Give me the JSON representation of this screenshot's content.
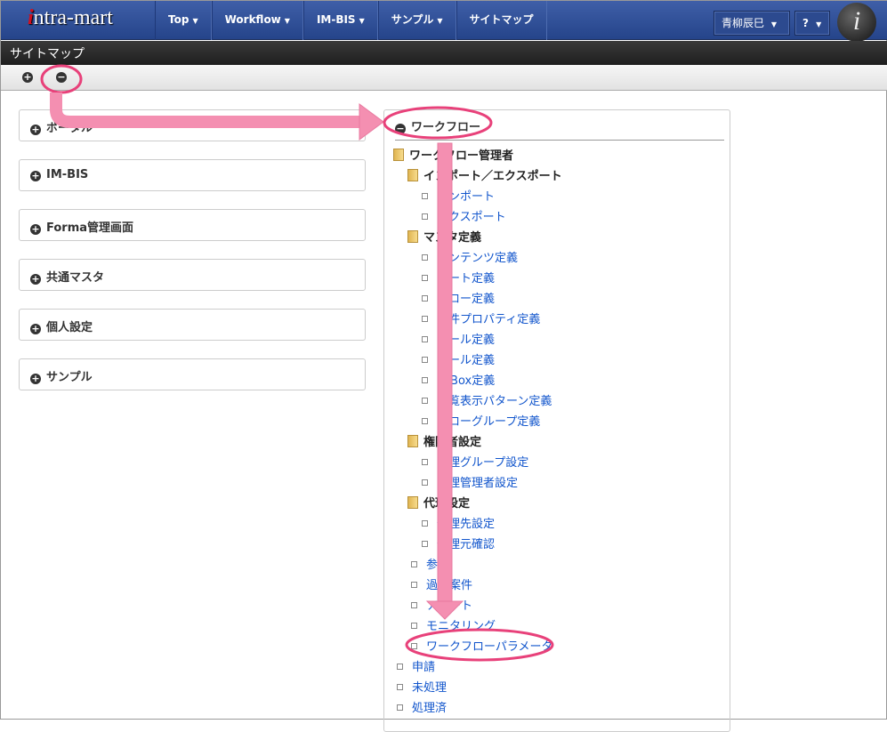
{
  "header": {
    "logo": "intra-mart",
    "nav": [
      {
        "label": "Top",
        "caret": true
      },
      {
        "label": "Workflow",
        "caret": true
      },
      {
        "label": "IM-BIS",
        "caret": true
      },
      {
        "label": "サンプル",
        "caret": true
      },
      {
        "label": "サイトマップ",
        "caret": false
      }
    ],
    "user": "青柳辰巳",
    "help": "?"
  },
  "title": "サイトマップ",
  "left_panels": [
    "ポータル",
    "IM-BIS",
    "Forma管理画面",
    "共通マスタ",
    "個人設定",
    "サンプル"
  ],
  "right": {
    "title": "ワークフロー",
    "tree": [
      {
        "l": 0,
        "t": "folder",
        "label": "ワークフロー管理者"
      },
      {
        "l": 1,
        "t": "folder",
        "label": "インポート／エクスポート"
      },
      {
        "l": 2,
        "t": "link",
        "label": "インポート"
      },
      {
        "l": 2,
        "t": "link",
        "label": "エクスポート"
      },
      {
        "l": 1,
        "t": "folder",
        "label": "マスタ定義"
      },
      {
        "l": 2,
        "t": "link",
        "label": "コンテンツ定義"
      },
      {
        "l": 2,
        "t": "link",
        "label": "ルート定義"
      },
      {
        "l": 2,
        "t": "link",
        "label": "フロー定義"
      },
      {
        "l": 2,
        "t": "link",
        "label": "案件プロパティ定義"
      },
      {
        "l": 2,
        "t": "link",
        "label": "メール定義"
      },
      {
        "l": 2,
        "t": "link",
        "label": "ルール定義"
      },
      {
        "l": 2,
        "t": "link",
        "label": "IMBox定義"
      },
      {
        "l": 2,
        "t": "link",
        "label": "一覧表示パターン定義"
      },
      {
        "l": 2,
        "t": "link",
        "label": "フローグループ定義"
      },
      {
        "l": 1,
        "t": "folder",
        "label": "権限者設定"
      },
      {
        "l": 2,
        "t": "link",
        "label": "管理グループ設定"
      },
      {
        "l": 2,
        "t": "link",
        "label": "管理管理者設定"
      },
      {
        "l": 1,
        "t": "folder",
        "label": "代理設定"
      },
      {
        "l": 2,
        "t": "link",
        "label": "代理先設定"
      },
      {
        "l": 2,
        "t": "link",
        "label": "代理元確認"
      },
      {
        "l": 1,
        "t": "link",
        "label": "参照"
      },
      {
        "l": 1,
        "t": "link",
        "label": "過去案件"
      },
      {
        "l": 1,
        "t": "link",
        "label": "アラート"
      },
      {
        "l": 1,
        "t": "link",
        "label": "モニタリング"
      },
      {
        "l": 1,
        "t": "link",
        "label": "ワークフローパラメータ"
      },
      {
        "l": 0,
        "t": "link",
        "label": "申請"
      },
      {
        "l": 0,
        "t": "link",
        "label": "未処理"
      },
      {
        "l": 0,
        "t": "link",
        "label": "処理済"
      }
    ]
  },
  "colors": {
    "annotation": "#e8417a",
    "arrow": "#f48fb1",
    "link": "#1155cc"
  }
}
